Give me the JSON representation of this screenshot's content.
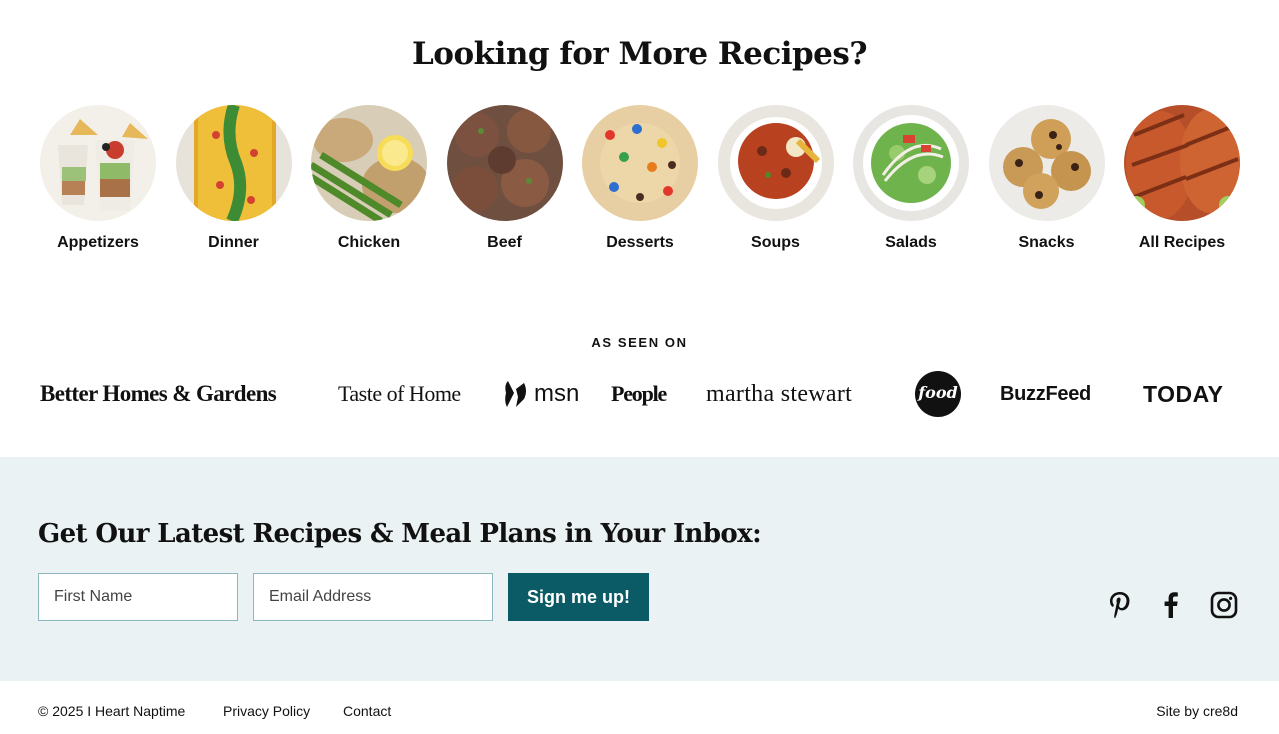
{
  "recipes": {
    "title": "Looking for More Recipes?",
    "categories": [
      {
        "label": "Appetizers",
        "icon": "appetizers-image"
      },
      {
        "label": "Dinner",
        "icon": "dinner-image"
      },
      {
        "label": "Chicken",
        "icon": "chicken-image"
      },
      {
        "label": "Beef",
        "icon": "beef-image"
      },
      {
        "label": "Desserts",
        "icon": "desserts-image"
      },
      {
        "label": "Soups",
        "icon": "soups-image"
      },
      {
        "label": "Salads",
        "icon": "salads-image"
      },
      {
        "label": "Snacks",
        "icon": "snacks-image"
      },
      {
        "label": "All Recipes",
        "icon": "all-recipes-image"
      }
    ]
  },
  "as_seen_on": {
    "heading": "AS SEEN ON",
    "logos": {
      "bhg": "Better Homes & Gardens",
      "toh": "Taste of Home",
      "msn": "msn",
      "people": "People",
      "martha": "martha stewart",
      "food": "food",
      "buzzfeed": "BuzzFeed",
      "today": "TODAY"
    }
  },
  "newsletter": {
    "title": "Get Our Latest Recipes & Meal Plans in Your Inbox:",
    "first_name_placeholder": "First Name",
    "email_placeholder": "Email Address",
    "submit_label": "Sign me up!",
    "background": "#eaf2f3",
    "button_color": "#0b5b66"
  },
  "social": [
    "pinterest-icon",
    "facebook-icon",
    "instagram-icon"
  ],
  "footer": {
    "copyright": "© 2025 I Heart Naptime",
    "privacy": "Privacy Policy",
    "contact": "Contact",
    "credit": "Site by cre8d"
  }
}
